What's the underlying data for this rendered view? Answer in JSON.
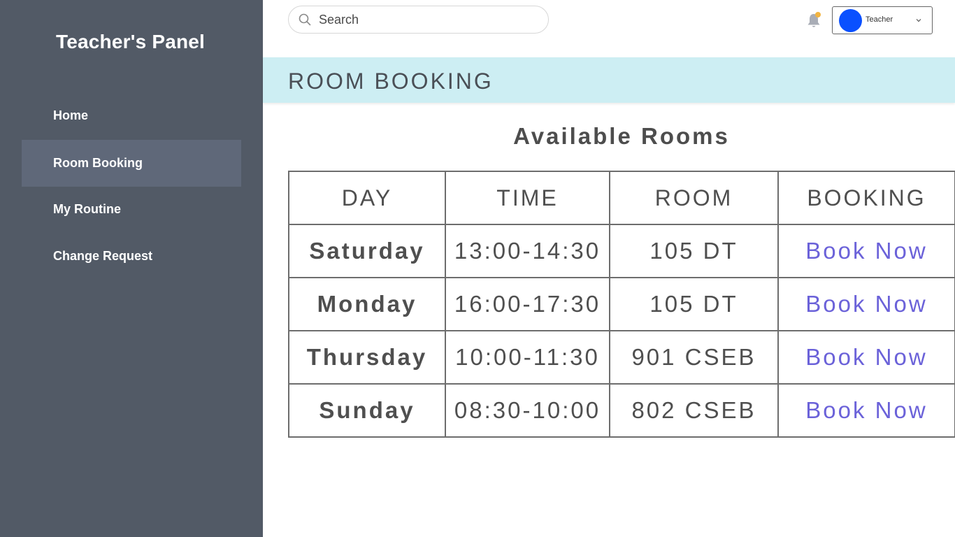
{
  "sidebar": {
    "brand": "Teacher's Panel",
    "items": [
      {
        "label": "Home"
      },
      {
        "label": "Room Booking"
      },
      {
        "label": "My Routine"
      },
      {
        "label": "Change Request"
      }
    ]
  },
  "topbar": {
    "search_placeholder": "Search",
    "user_label": "Teacher"
  },
  "page": {
    "title": "ROOM BOOKING",
    "section_title": "Available Rooms"
  },
  "table": {
    "headers": [
      "DAY",
      "TIME",
      "ROOM",
      "BOOKING"
    ],
    "rows": [
      {
        "day": "Saturday",
        "time": "13:00-14:30",
        "room": "105 DT",
        "action": "Book Now"
      },
      {
        "day": "Monday",
        "time": "16:00-17:30",
        "room": "105 DT",
        "action": "Book Now"
      },
      {
        "day": "Thursday",
        "time": "10:00-11:30",
        "room": "901 CSEB",
        "action": "Book Now"
      },
      {
        "day": "Sunday",
        "time": "08:30-10:00",
        "room": "802 CSEB",
        "action": "Book Now"
      }
    ]
  },
  "colors": {
    "sidebar_bg": "#525a66",
    "sidebar_active": "#5f6879",
    "header_bg": "#cdeef3",
    "link": "#6b62d9",
    "avatar": "#0a50ff",
    "notification_dot": "#f2b441"
  },
  "icons": [
    "search-icon",
    "bell-icon",
    "chevron-down-icon"
  ]
}
